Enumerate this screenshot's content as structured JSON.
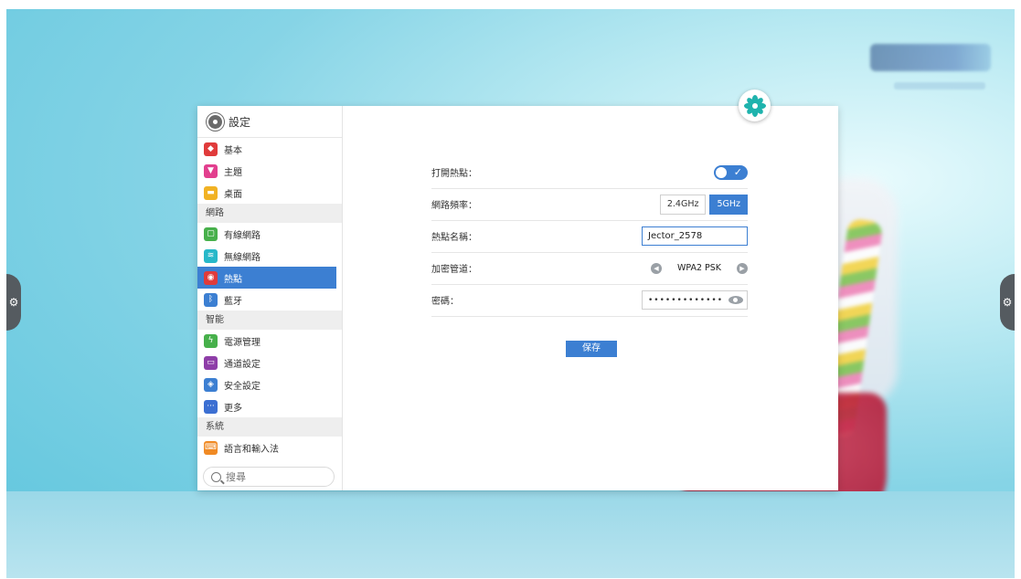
{
  "settings": {
    "title": "設定",
    "search_placeholder": "搜尋",
    "sidebar": {
      "items_group1": [
        {
          "label": "基本",
          "icon": "stack-icon",
          "color": "#e03b3b"
        },
        {
          "label": "主題",
          "icon": "shirt-icon",
          "color": "#e23f8e"
        },
        {
          "label": "桌面",
          "icon": "picture-icon",
          "color": "#f1b224"
        }
      ],
      "section_network": "網路",
      "items_network": [
        {
          "label": "有線網路",
          "icon": "monitor-icon",
          "color": "#47b04b"
        },
        {
          "label": "無線網路",
          "icon": "wifi-icon",
          "color": "#27b8c9"
        },
        {
          "label": "熱點",
          "icon": "hotspot-icon",
          "color": "#e03b3b",
          "active": true
        },
        {
          "label": "藍牙",
          "icon": "bluetooth-icon",
          "color": "#3c7fd2"
        }
      ],
      "section_smart": "智能",
      "items_smart": [
        {
          "label": "電源管理",
          "icon": "lightning-icon",
          "color": "#47b04b"
        },
        {
          "label": "通道設定",
          "icon": "screen-icon",
          "color": "#8e3ea8"
        },
        {
          "label": "安全設定",
          "icon": "shield-icon",
          "color": "#3c7fd2"
        },
        {
          "label": "更多",
          "icon": "more-icon",
          "color": "#3c6fd2"
        }
      ],
      "section_system": "系統",
      "items_system": [
        {
          "label": "語言和輸入法",
          "icon": "keyboard-icon",
          "color": "#f08a24"
        }
      ]
    },
    "hotspot": {
      "enable_label": "打開熱點：",
      "enabled": true,
      "band_label": "網路頻率：",
      "band_options": [
        "2.4GHz",
        "5GHz"
      ],
      "band_selected": "5GHz",
      "name_label": "熱點名稱：",
      "name_value": "Jector_2578",
      "security_label": "加密管道：",
      "security_value": "WPA2 PSK",
      "password_label": "密碼：",
      "password_masked": "•••••••••••••",
      "save_label": "保存"
    }
  },
  "colors": {
    "accent": "#3c7fd2"
  }
}
